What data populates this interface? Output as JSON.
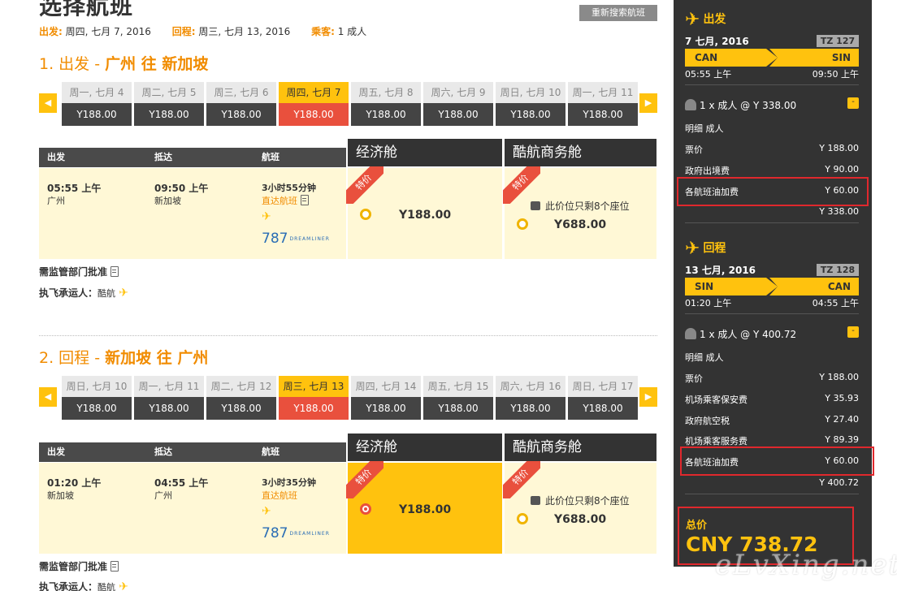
{
  "header": {
    "page_title": "选择航班",
    "research_button": "重新搜索航班",
    "depart_label": "出发:",
    "depart_value": "周四, 七月 7, 2016",
    "return_label": "回程:",
    "return_value": "周三, 七月 13, 2016",
    "pax_label": "乘客:",
    "pax_value": "1 成人"
  },
  "outbound": {
    "title_num": "1. 出发 - ",
    "title_route": "广州 往 新加坡",
    "dates": [
      {
        "label": "周一, 七月 4",
        "price": "Y188.00"
      },
      {
        "label": "周二, 七月 5",
        "price": "Y188.00"
      },
      {
        "label": "周三, 七月 6",
        "price": "Y188.00"
      },
      {
        "label": "周四, 七月 7",
        "price": "Y188.00"
      },
      {
        "label": "周五, 七月 8",
        "price": "Y188.00"
      },
      {
        "label": "周六, 七月 9",
        "price": "Y188.00"
      },
      {
        "label": "周日, 七月 10",
        "price": "Y188.00"
      },
      {
        "label": "周一, 七月 11",
        "price": "Y188.00"
      }
    ],
    "selected_date_index": 3,
    "columns": {
      "depart": "出发",
      "arrive": "抵达",
      "flight": "航班",
      "economy": "经济舱",
      "business": "酷航商务舱"
    },
    "flight": {
      "depart_time": "05:55 上午",
      "depart_city": "广州",
      "arrive_time": "09:50 上午",
      "arrive_city": "新加坡",
      "duration": "3小时55分钟",
      "direct": "直达航班",
      "aircraft": "787",
      "aircraft_brand": "DREAMLINER"
    },
    "economy": {
      "badge": "特价",
      "price": "Y188.00",
      "selected": false
    },
    "business": {
      "badge": "特价",
      "seats_note": "此价位只剩8个座位",
      "price": "Y688.00"
    },
    "approval_note": "需监管部门批准",
    "carrier_label": "执飞承运人：",
    "carrier_value": "酷航"
  },
  "inbound": {
    "title_num": "2. 回程 - ",
    "title_route": "新加坡 往 广州",
    "dates": [
      {
        "label": "周日, 七月 10",
        "price": "Y188.00"
      },
      {
        "label": "周一, 七月 11",
        "price": "Y188.00"
      },
      {
        "label": "周二, 七月 12",
        "price": "Y188.00"
      },
      {
        "label": "周三, 七月 13",
        "price": "Y188.00"
      },
      {
        "label": "周四, 七月 14",
        "price": "Y188.00"
      },
      {
        "label": "周五, 七月 15",
        "price": "Y188.00"
      },
      {
        "label": "周六, 七月 16",
        "price": "Y188.00"
      },
      {
        "label": "周日, 七月 17",
        "price": "Y188.00"
      }
    ],
    "selected_date_index": 3,
    "columns": {
      "depart": "出发",
      "arrive": "抵达",
      "flight": "航班",
      "economy": "经济舱",
      "business": "酷航商务舱"
    },
    "flight": {
      "depart_time": "01:20 上午",
      "depart_city": "新加坡",
      "arrive_time": "04:55 上午",
      "arrive_city": "广州",
      "duration": "3小时35分钟",
      "direct": "直达航班",
      "aircraft": "787",
      "aircraft_brand": "DREAMLINER"
    },
    "economy": {
      "badge": "特价",
      "price": "Y188.00",
      "selected": true
    },
    "business": {
      "badge": "特价",
      "seats_note": "此价位只剩8个座位",
      "price": "Y688.00"
    },
    "approval_note": "需监管部门批准",
    "carrier_label": "执飞承运人：",
    "carrier_value": "酷航"
  },
  "sidebar": {
    "out": {
      "heading": "出发",
      "date": "7 七月, 2016",
      "flight_no": "TZ 127",
      "from": "CAN",
      "to": "SIN",
      "dep_time": "05:55 上午",
      "arr_time": "09:50 上午",
      "pax_line": "1 x 成人 @ Y 338.00",
      "toggle": "-",
      "detail_title": "明细 成人",
      "rows": [
        {
          "label": "票价",
          "value": "Y 188.00"
        },
        {
          "label": "政府出境费",
          "value": "Y 90.00"
        },
        {
          "label": "各航班油加费",
          "value": "Y 60.00"
        }
      ],
      "subtotal": "Y 338.00"
    },
    "ret": {
      "heading": "回程",
      "date": "13 七月, 2016",
      "flight_no": "TZ 128",
      "from": "SIN",
      "to": "CAN",
      "dep_time": "01:20 上午",
      "arr_time": "04:55 上午",
      "pax_line": "1 x 成人 @ Y 400.72",
      "toggle": "-",
      "detail_title": "明细 成人",
      "rows": [
        {
          "label": "票价",
          "value": "Y 188.00"
        },
        {
          "label": "机场乘客保安费",
          "value": "Y 35.93"
        },
        {
          "label": "政府航空税",
          "value": "Y 27.40"
        },
        {
          "label": "机场乘客服务费",
          "value": "Y 89.39"
        },
        {
          "label": "各航班油加费",
          "value": "Y 60.00"
        }
      ],
      "subtotal": "Y 400.72"
    },
    "total_label": "总价",
    "total_value": "CNY 738.72"
  },
  "watermark": "eLvXing.net",
  "colors": {
    "accent": "#ffc20e",
    "orange_text": "#f18c00",
    "selected_red": "#e9503d",
    "sidebar_bg": "#333333",
    "annotation_red": "#e0282d"
  }
}
